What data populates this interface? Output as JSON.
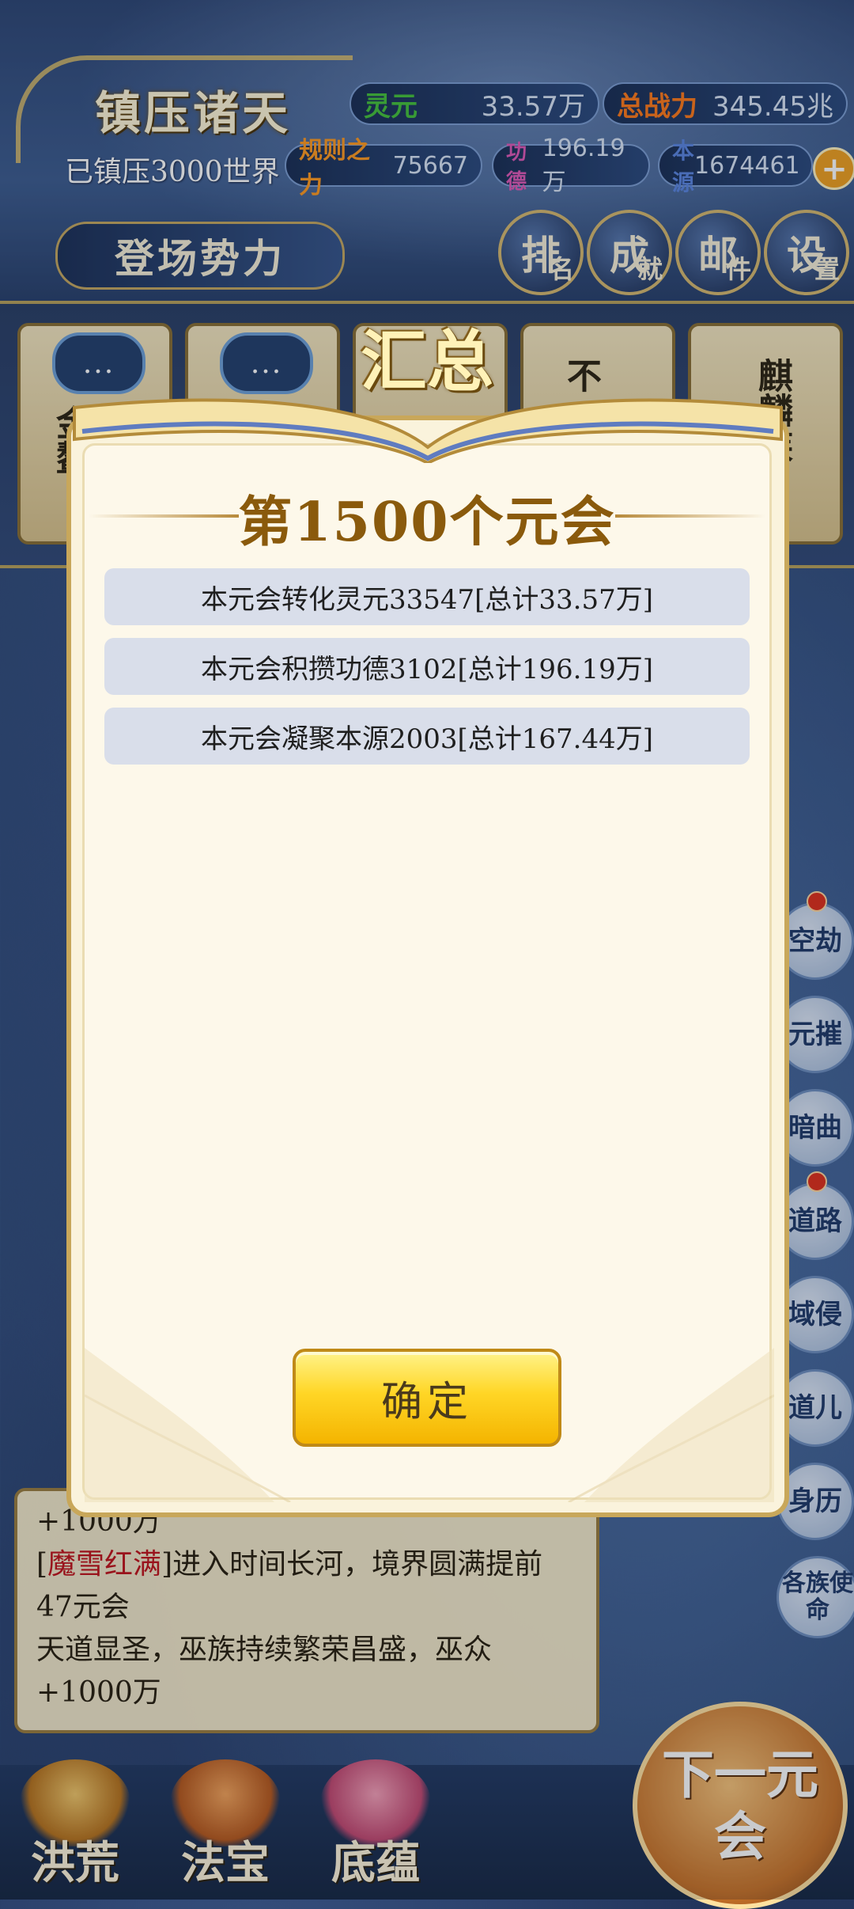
{
  "header": {
    "title": "镇压诸天",
    "subtitle": "已镇压3000世界",
    "spawn_button": "登场势力",
    "stats": [
      {
        "label": "灵元",
        "value": "33.57万",
        "color": "#46c23c"
      },
      {
        "label": "总战力",
        "value": "345.45兆",
        "color": "#ff7a1a"
      },
      {
        "label": "规则之力",
        "value": "75667",
        "color": "#ff9a20"
      },
      {
        "label": "功德",
        "value": "196.19万",
        "color": "#e05ab8"
      },
      {
        "label": "本源",
        "value": "1674461",
        "color": "#5c86e0"
      }
    ],
    "menu": [
      {
        "main": "排",
        "small": "名"
      },
      {
        "main": "成",
        "small": "就"
      },
      {
        "main": "邮",
        "small": "件"
      },
      {
        "main": "设",
        "small": "置"
      }
    ]
  },
  "faction_cards": [
    {
      "bubble": "...",
      "text": "金鳌"
    },
    {
      "bubble": "...",
      "text": ""
    },
    {
      "bubble": "",
      "text": ""
    },
    {
      "bubble": "",
      "text": "不"
    },
    {
      "bubble": "",
      "text": "麒麟族"
    }
  ],
  "side_buttons": [
    {
      "label": "空劫",
      "dot": true
    },
    {
      "label": "元摧",
      "dot": false
    },
    {
      "label": "暗曲",
      "dot": false
    },
    {
      "label": "道路",
      "dot": true
    },
    {
      "label": "域侵",
      "dot": false
    },
    {
      "label": "道儿",
      "dot": false
    },
    {
      "label": "身历",
      "dot": false
    },
    {
      "label": "各族使命",
      "dot": false
    }
  ],
  "log": {
    "line1": "+1000万",
    "name": "魔雪红满",
    "line2_bracket_open": "[",
    "line2_bracket_close": "]",
    "line2_rest": "进入时间长河，境界圆满提前47元会",
    "line3": "天道显圣，巫族持续繁荣昌盛，巫众+1000万"
  },
  "bottom_nav": [
    {
      "label": "洪荒",
      "color": "#f2c76a"
    },
    {
      "label": "法宝",
      "color": "#e88a3a"
    },
    {
      "label": "底蕴",
      "color": "#e56a8a"
    }
  ],
  "next_button": "下一元会",
  "modal": {
    "badge": "汇总",
    "heading": "第1500个元会",
    "rows": [
      "本元会转化灵元33547[总计33.57万]",
      "本元会积攒功德3102[总计196.19万]",
      "本元会凝聚本源2003[总计167.44万]"
    ],
    "confirm": "确定"
  }
}
